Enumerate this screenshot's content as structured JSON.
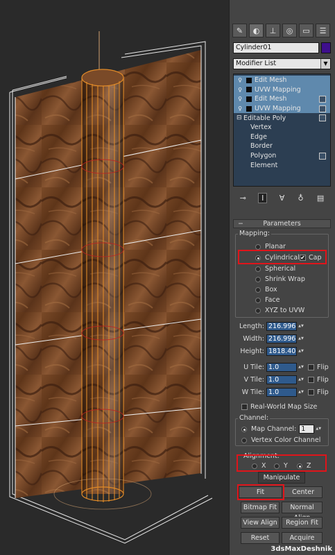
{
  "viewport": {
    "object": "cylinder with wood texture"
  },
  "command_panel": {
    "tabs": [
      {
        "icon": "create-icon"
      },
      {
        "icon": "modify-icon"
      },
      {
        "icon": "hierarchy-icon"
      },
      {
        "icon": "motion-icon"
      },
      {
        "icon": "display-icon"
      },
      {
        "icon": "utilities-icon"
      }
    ],
    "object_name": "Cylinder01",
    "object_color": "#3e0f8c",
    "modifier_list_label": "Modifier List",
    "stack": [
      {
        "label": "Edit Mesh",
        "selected": true
      },
      {
        "label": "UVW Mapping",
        "selected": true
      },
      {
        "label": "Edit Mesh",
        "selected": true
      },
      {
        "label": "UVW Mapping",
        "selected": true
      },
      {
        "label": "Editable Poly",
        "selected": false
      }
    ],
    "sub_objects": [
      "Vertex",
      "Edge",
      "Border",
      "Polygon",
      "Element"
    ],
    "parameters_title": "Parameters",
    "mapping_label": "Mapping:",
    "mapping_options": [
      {
        "label": "Planar",
        "checked": false
      },
      {
        "label": "Cylindrical",
        "checked": true
      },
      {
        "label": "Spherical",
        "checked": false
      },
      {
        "label": "Shrink Wrap",
        "checked": false
      },
      {
        "label": "Box",
        "checked": false
      },
      {
        "label": "Face",
        "checked": false
      },
      {
        "label": "XYZ to UVW",
        "checked": false
      }
    ],
    "cap_label": "Cap",
    "cap_checked": true,
    "length_label": "Length:",
    "length_value": "216.996",
    "width_label": "Width:",
    "width_value": "216.996",
    "height_label": "Height:",
    "height_value": "1818.40",
    "u_tile_label": "U Tile:",
    "u_tile_value": "1.0",
    "v_tile_label": "V Tile:",
    "v_tile_value": "1.0",
    "w_tile_label": "W Tile:",
    "w_tile_value": "1.0",
    "flip_label": "Flip",
    "real_world_label": "Real-World Map Size",
    "channel_label": "Channel:",
    "map_channel_label": "Map Channel:",
    "map_channel_value": "1",
    "vertex_color_channel_label": "Vertex Color Channel",
    "alignment_label": "Alignment:",
    "axis_x": "X",
    "axis_y": "Y",
    "axis_z": "Z",
    "manipulate_label": "Manipulate",
    "fit_label": "Fit",
    "center_label": "Center",
    "bitmap_fit_label": "Bitmap Fit",
    "normal_align_label": "Normal Align",
    "view_align_label": "View Align",
    "region_fit_label": "Region Fit",
    "reset_label": "Reset",
    "acquire_label": "Acquire"
  },
  "watermark": "3dsMaxDeshnik",
  "colors": {
    "highlight": "#e0141a",
    "selection": "#5f89ad",
    "wood": "#6b3f22"
  }
}
